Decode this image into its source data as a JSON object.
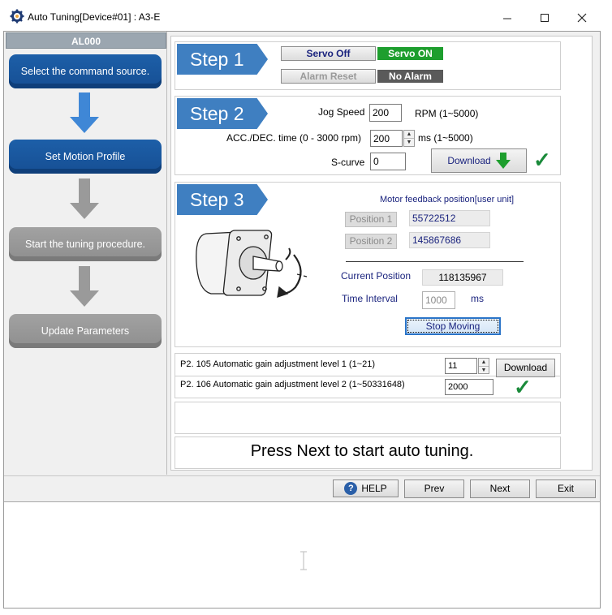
{
  "window": {
    "title": "Auto Tuning[Device#01] : A3-E",
    "app_icon": "gear-icon",
    "controls": [
      "minimize-icon",
      "maximize-icon",
      "close-icon"
    ]
  },
  "left_panel": {
    "alarm_code": "AL000",
    "flow": [
      {
        "label": "Select the command source.",
        "state": "active"
      },
      {
        "label": "Set Motion Profile",
        "state": "active"
      },
      {
        "label": "Start the tuning procedure.",
        "state": "inactive"
      },
      {
        "label": "Update Parameters",
        "state": "inactive"
      }
    ]
  },
  "step1": {
    "label": "Step 1",
    "servo_off": "Servo Off",
    "servo_on": "Servo ON",
    "alarm_reset": "Alarm Reset",
    "alarm_status": "No Alarm"
  },
  "step2": {
    "label": "Step 2",
    "jog_speed_label": "Jog Speed",
    "jog_speed_value": "200",
    "jog_speed_unit": "RPM (1~5000)",
    "acc_label": "ACC./DEC. time (0 - 3000 rpm)",
    "acc_value": "200",
    "acc_unit": "ms (1~5000)",
    "scurve_label": "S-curve",
    "scurve_value": "0",
    "download": "Download"
  },
  "step3": {
    "label": "Step 3",
    "feedback_title": "Motor feedback position[user unit]",
    "position1_label": "Position 1",
    "position1_value": "55722512",
    "position2_label": "Position 2",
    "position2_value": "145867686",
    "current_position_label": "Current Position",
    "current_position_value": "118135967",
    "time_interval_label": "Time Interval",
    "time_interval_value": "1000",
    "time_interval_unit": "ms",
    "stop_button": "Stop Moving"
  },
  "params": {
    "p2_105_label": "P2. 105 Automatic gain adjustment level 1 (1~21)",
    "p2_105_value": "11",
    "p2_106_label": "P2. 106 Automatic gain adjustment level 2 (1~50331648)",
    "p2_106_value": "2000",
    "download": "Download"
  },
  "message": "Press Next to start auto tuning.",
  "buttons": {
    "help": "HELP",
    "prev": "Prev",
    "next": "Next",
    "exit": "Exit"
  },
  "colors": {
    "step_blue": "#3f7fc1",
    "flow_blue": "#1d5fa8",
    "servo_on_green": "#1e9e2e",
    "no_alarm_gray": "#5a5a5a",
    "check_green": "#1a8a3a"
  }
}
